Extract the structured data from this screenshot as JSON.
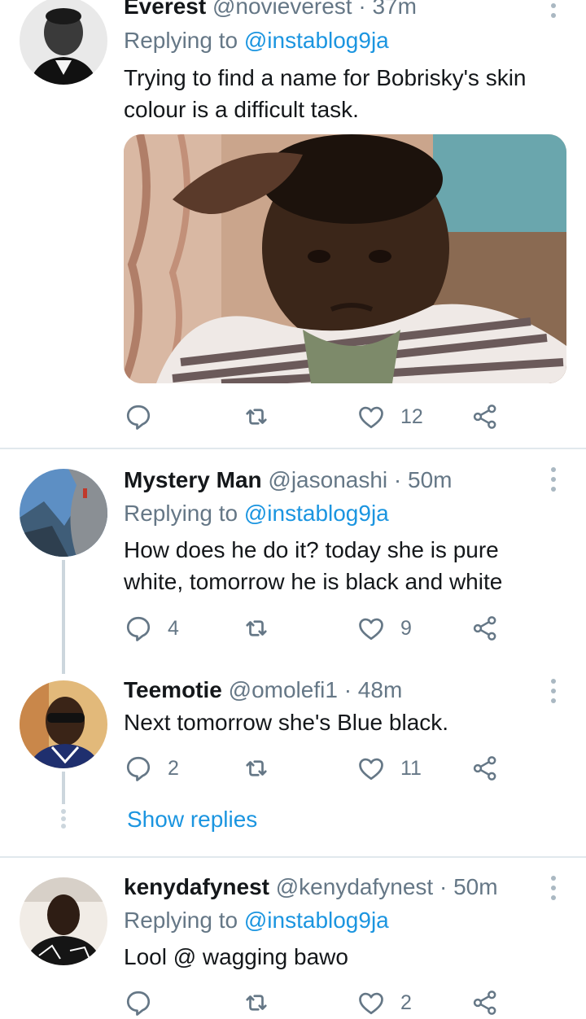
{
  "tweets": [
    {
      "name": "Everest",
      "handle": "@novieverest",
      "time": "37m",
      "replying_prefix": "Replying to",
      "replying_to": "@instablog9ja",
      "text": "Trying to find a name for Bobrisky's skin colour is a difficult task.",
      "reply_count": "",
      "like_count": "12"
    },
    {
      "name": "Mystery Man",
      "handle": "@jasonashi",
      "time": "50m",
      "replying_prefix": "Replying to",
      "replying_to": "@instablog9ja",
      "text": "How does he do it? today she is pure white, tomorrow he is black and white",
      "reply_count": "4",
      "like_count": "9"
    },
    {
      "name": "Teemotie",
      "handle": "@omolefi1",
      "time": "48m",
      "text": "Next tomorrow she's Blue black.",
      "reply_count": "2",
      "like_count": "11"
    },
    {
      "name": "kenydafynest",
      "handle": "@kenydafynest",
      "time": "50m",
      "replying_prefix": "Replying to",
      "replying_to": "@instablog9ja",
      "text": "Lool @ wagging bawo",
      "reply_count": "",
      "like_count": "2"
    }
  ],
  "show_replies": "Show replies",
  "separator": "·",
  "colors": {
    "link": "#1b95e0",
    "secondary": "#657786",
    "divider": "#e1e8ed"
  }
}
